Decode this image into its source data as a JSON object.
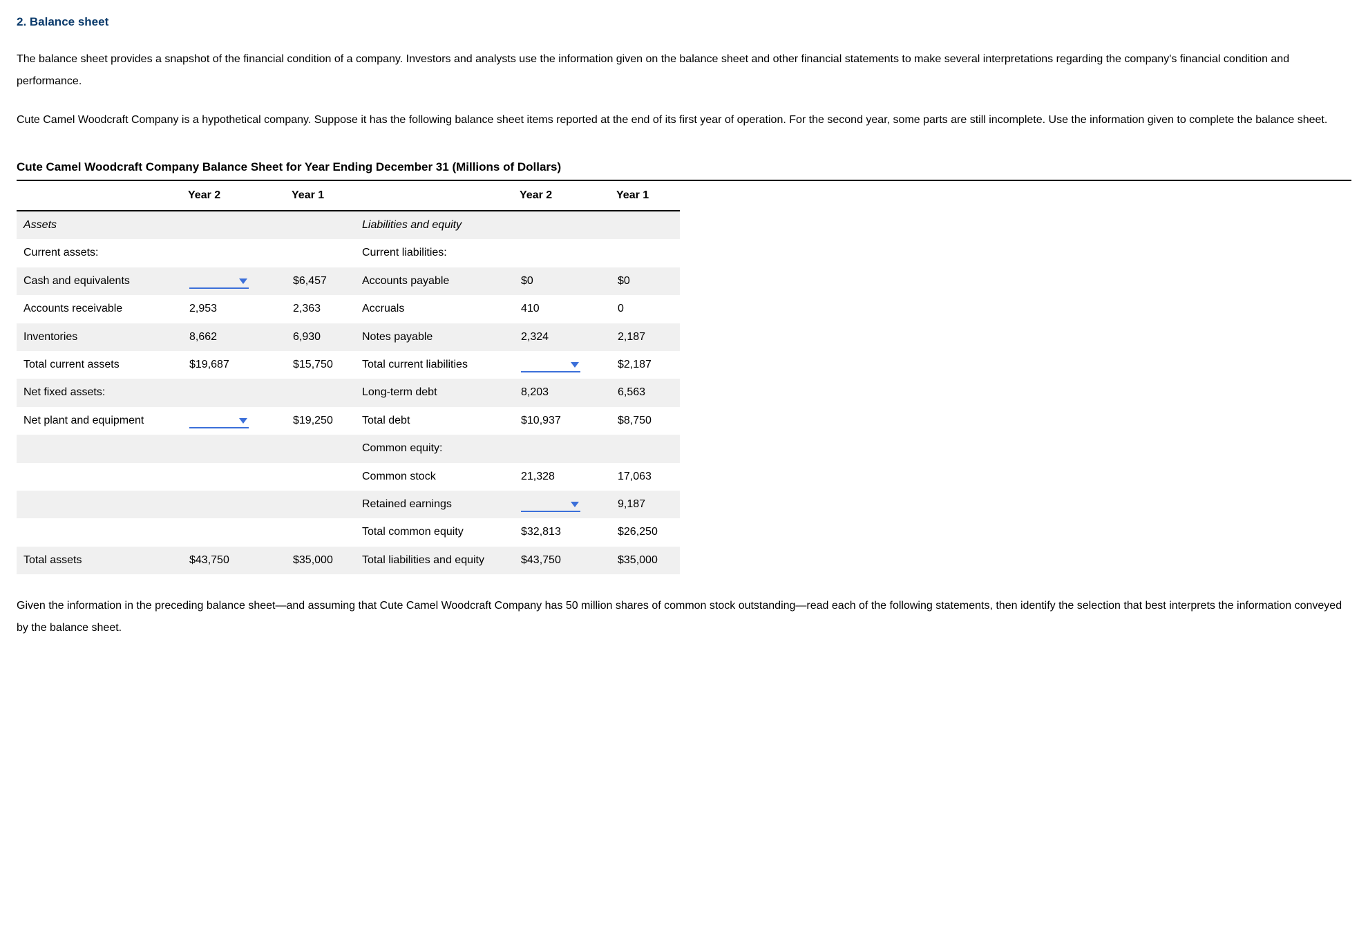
{
  "heading": "2. Balance sheet",
  "intro_p1": "The balance sheet provides a snapshot of the financial condition of a company. Investors and analysts use the information given on the balance sheet and other financial statements to make several interpretations regarding the company's financial condition and performance.",
  "intro_p2": "Cute Camel Woodcraft Company is a hypothetical company. Suppose it has the following balance sheet items reported at the end of its first year of operation. For the second year, some parts are still incomplete. Use the information given to complete the balance sheet.",
  "table_title": "Cute Camel Woodcraft Company Balance Sheet for Year Ending December 31 (Millions of Dollars)",
  "hdr": {
    "y2": "Year 2",
    "y1": "Year 1"
  },
  "left": {
    "assets": "Assets",
    "current_assets": "Current assets:",
    "cash": "Cash and equivalents",
    "cash_y1": "$6,457",
    "ar": "Accounts receivable",
    "ar_y2": "2,953",
    "ar_y1": "2,363",
    "inv": "Inventories",
    "inv_y2": "8,662",
    "inv_y1": "6,930",
    "tca": "Total current assets",
    "tca_y2": "$19,687",
    "tca_y1": "$15,750",
    "nfa": "Net fixed assets:",
    "npe": "Net plant and equipment",
    "npe_y1": "$19,250",
    "ta": "Total assets",
    "ta_y2": "$43,750",
    "ta_y1": "$35,000"
  },
  "right": {
    "liab_eq": "Liabilities and equity",
    "cur_liab": "Current liabilities:",
    "ap": "Accounts payable",
    "ap_y2": "$0",
    "ap_y1": "$0",
    "accr": "Accruals",
    "accr_y2": "410",
    "accr_y1": "0",
    "np": "Notes payable",
    "np_y2": "2,324",
    "np_y1": "2,187",
    "tcl": "Total current liabilities",
    "tcl_y1": "$2,187",
    "ltd": "Long-term debt",
    "ltd_y2": "8,203",
    "ltd_y1": "6,563",
    "td": "Total debt",
    "td_y2": "$10,937",
    "td_y1": "$8,750",
    "ce": "Common equity:",
    "cs": "Common stock",
    "cs_y2": "21,328",
    "cs_y1": "17,063",
    "re": "Retained earnings",
    "re_y1": "9,187",
    "tce": "Total common equity",
    "tce_y2": "$32,813",
    "tce_y1": "$26,250",
    "tle": "Total liabilities and equity",
    "tle_y2": "$43,750",
    "tle_y1": "$35,000"
  },
  "bottom": "Given the information in the preceding balance sheet—and assuming that Cute Camel Woodcraft Company has 50 million shares of common stock outstanding—read each of the following statements, then identify the selection that best interprets the information conveyed by the balance sheet."
}
